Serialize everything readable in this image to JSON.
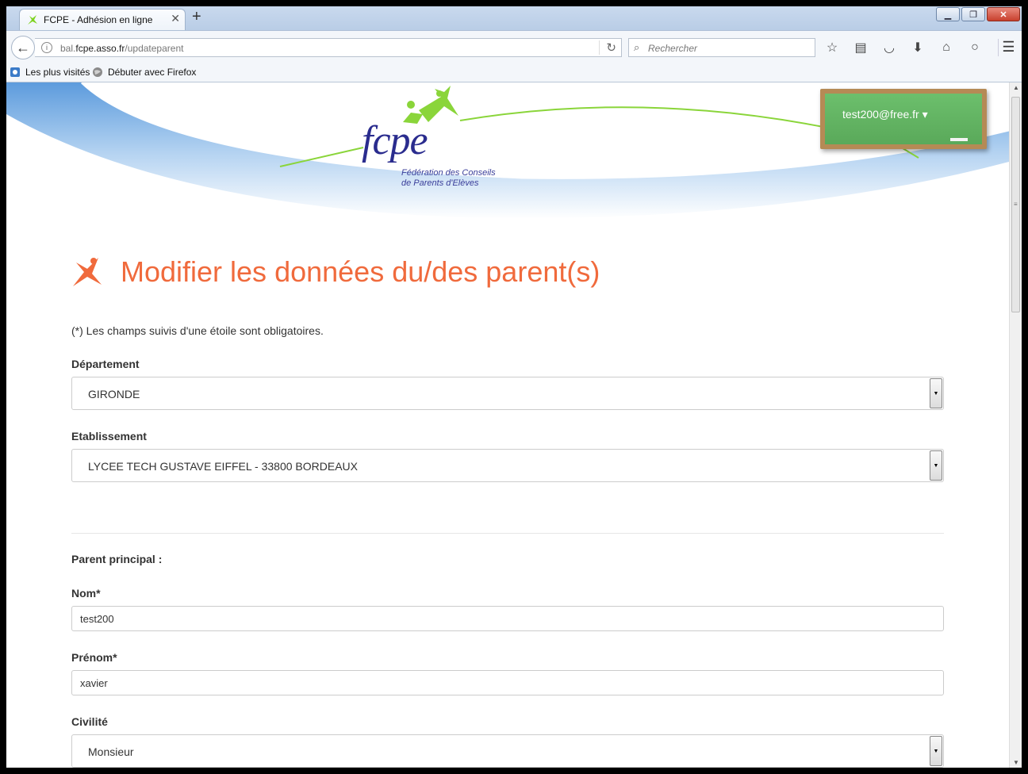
{
  "browser": {
    "tab_title": "FCPE - Adhésion en ligne",
    "tab_close": "✕",
    "new_tab": "+",
    "url_prefix": "bal.",
    "url_domain": "fcpe.asso.fr",
    "url_path": "/updateparent",
    "search_placeholder": "Rechercher",
    "bookmarks": [
      {
        "label": "Les plus visités"
      },
      {
        "label": "Débuter avec Firefox"
      }
    ]
  },
  "header": {
    "logo_text": "fcpe",
    "logo_sub_line1": "Fédération des Conseils",
    "logo_sub_line2": "de Parents d'Elèves",
    "user_menu": "test200@free.fr"
  },
  "page": {
    "title": "Modifier les données du/des parent(s)",
    "required_note": "(*) Les champs suivis d'une étoile sont obligatoires."
  },
  "form": {
    "departement": {
      "label": "Département",
      "value": "GIRONDE"
    },
    "etablissement": {
      "label": "Etablissement",
      "value": "LYCEE TECH GUSTAVE EIFFEL - 33800 BORDEAUX"
    },
    "section_parent": "Parent principal :",
    "nom": {
      "label": "Nom*",
      "value": "test200"
    },
    "prenom": {
      "label": "Prénom*",
      "value": "xavier"
    },
    "civilite": {
      "label": "Civilité",
      "value": "Monsieur"
    }
  },
  "colors": {
    "accent_orange": "#f06a3c",
    "logo_blue": "#2a2c8e",
    "logo_green": "#7ed321",
    "board_green": "#5aa95a"
  }
}
